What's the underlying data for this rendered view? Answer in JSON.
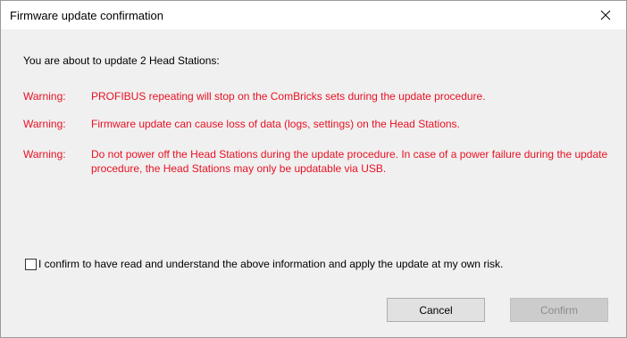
{
  "window": {
    "title": "Firmware update confirmation",
    "close_icon": "close-icon"
  },
  "message": {
    "intro": "You are about to update 2 Head Stations:",
    "warnings": [
      {
        "label": "Warning:",
        "text": "PROFIBUS repeating will stop on the ComBricks sets during the update procedure."
      },
      {
        "label": "Warning:",
        "text": "Firmware update can cause loss of data (logs, settings) on the Head Stations."
      },
      {
        "label": "Warning:",
        "text": "Do not power off the Head Stations during the update procedure. In case of a power failure during the update procedure, the Head Stations may only be updatable via USB."
      }
    ],
    "warning_color": "#e81123"
  },
  "confirm_checkbox": {
    "label": "I confirm to have read and understand the above information and apply the update at my own risk.",
    "checked": false
  },
  "buttons": {
    "cancel_label": "Cancel",
    "confirm_label": "Confirm",
    "confirm_enabled": false
  }
}
